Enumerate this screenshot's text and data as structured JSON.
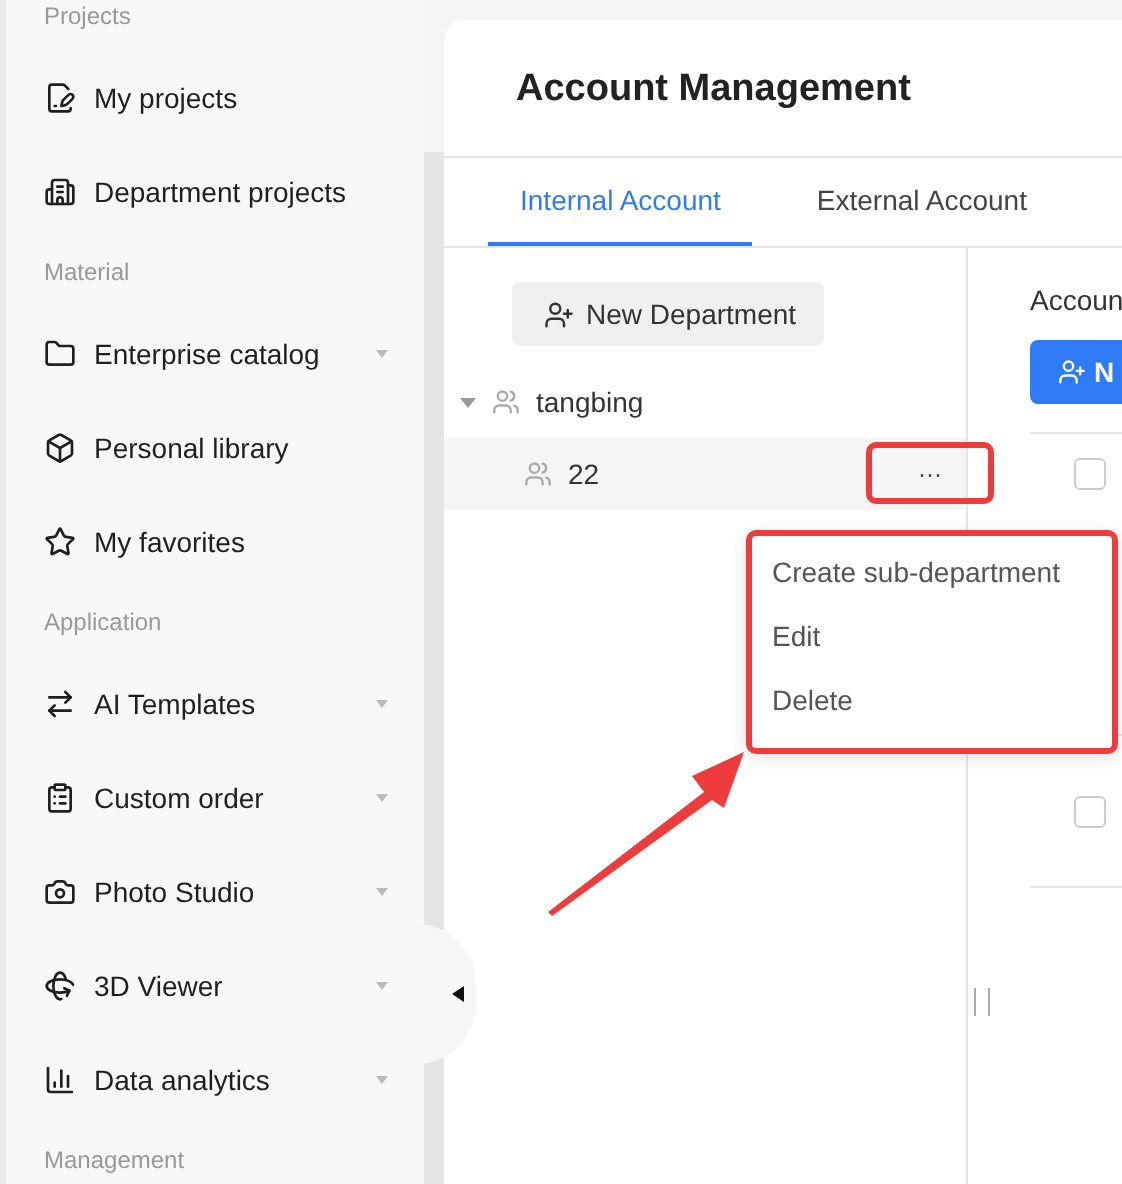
{
  "sidebar": {
    "sections": [
      {
        "title": "Projects",
        "items": [
          {
            "label": "My projects",
            "has_submenu": false
          },
          {
            "label": "Department projects",
            "has_submenu": false
          }
        ]
      },
      {
        "title": "Material",
        "items": [
          {
            "label": "Enterprise catalog",
            "has_submenu": true
          },
          {
            "label": "Personal library",
            "has_submenu": false
          },
          {
            "label": "My favorites",
            "has_submenu": false
          }
        ]
      },
      {
        "title": "Application",
        "items": [
          {
            "label": "AI Templates",
            "has_submenu": true
          },
          {
            "label": "Custom order",
            "has_submenu": true
          },
          {
            "label": "Photo Studio",
            "has_submenu": true
          },
          {
            "label": "3D Viewer",
            "has_submenu": true
          },
          {
            "label": "Data analytics",
            "has_submenu": true
          }
        ]
      },
      {
        "title": "Management"
      }
    ]
  },
  "page": {
    "title": "Account Management"
  },
  "tabs": [
    {
      "label": "Internal Account",
      "selected": true
    },
    {
      "label": "External Account",
      "selected": false
    }
  ],
  "tree": {
    "new_button": "New Department",
    "nodes": [
      {
        "label": "tangbing",
        "expanded": true,
        "children": [
          {
            "label": "22",
            "selected": true,
            "more": "···"
          }
        ]
      }
    ]
  },
  "context_menu": {
    "items": [
      "Create sub-department",
      "Edit",
      "Delete"
    ]
  },
  "accounts": {
    "title": "Accoun",
    "new_button": "N",
    "rows": [
      {
        "checked": false
      },
      {
        "checked": false
      }
    ]
  }
}
